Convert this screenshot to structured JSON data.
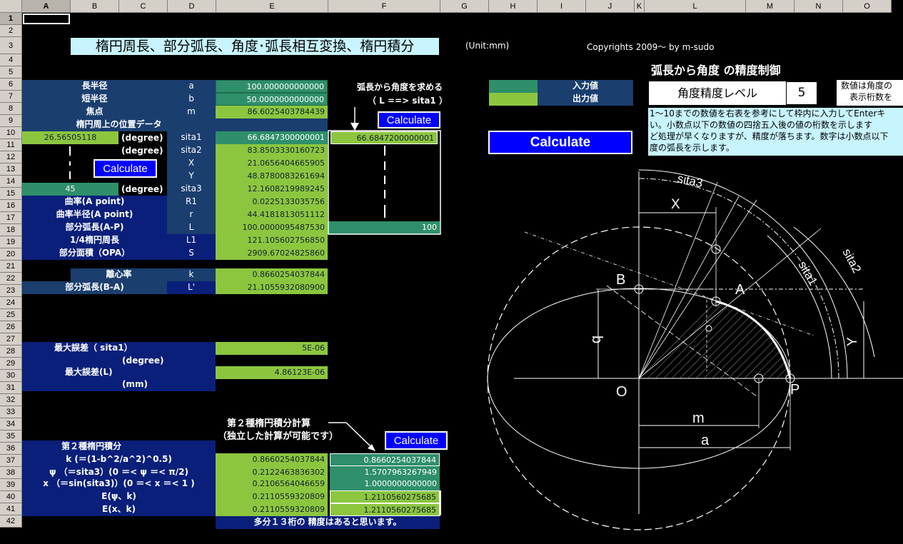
{
  "columns": [
    "A",
    "B",
    "C",
    "D",
    "E",
    "F",
    "G",
    "H",
    "I",
    "J",
    "K",
    "L",
    "M",
    "N",
    "O"
  ],
  "rows": [
    "1",
    "2",
    "3",
    "4",
    "5",
    "6",
    "7",
    "8",
    "9",
    "10",
    "11",
    "12",
    "13",
    "14",
    "15",
    "16",
    "17",
    "18",
    "19",
    "20",
    "21",
    "22",
    "23",
    "24",
    "25",
    "26",
    "27",
    "28",
    "29",
    "30",
    "31",
    "32",
    "33",
    "34",
    "35",
    "36",
    "37",
    "38",
    "39",
    "40",
    "41",
    "42"
  ],
  "title": "楕円周長、部分弧長、角度･弧長相互変換、楕円積分",
  "unit": "(Unit:mm)",
  "copyright": "Copyrights 2009～ by m-sudo",
  "params": [
    {
      "label": "長半径",
      "sym": "a",
      "value": "100.000000000000"
    },
    {
      "label": "短半径",
      "sym": "b",
      "value": "50.0000000000000"
    },
    {
      "label": "焦点",
      "sym": "m",
      "value": "86.6025403784439"
    }
  ],
  "position_header": "楕円周上の位置データ",
  "rows10": {
    "input": "26.56505118",
    "deg": "(degree)",
    "sym": "sita1",
    "value": "66.6847300000001",
    "out": "66.6847200000001"
  },
  "rows11": {
    "deg": "(degree)",
    "sym": "sita2",
    "value": "83.8503330160723"
  },
  "rows12": {
    "sym": "X",
    "value": "21.0656404665905"
  },
  "rows13": {
    "sym": "Y",
    "value": "48.8780083261694"
  },
  "rows14": {
    "input": "45",
    "deg": "(degree)",
    "sym": "sita3",
    "value": "12.1608219989245"
  },
  "rows15": {
    "label": "曲率(A point)",
    "sym": "R1",
    "value": "0.0225133035756"
  },
  "rows16": {
    "label": "曲率半径(A point)",
    "sym": "r",
    "value": "44.4181813051112"
  },
  "rows17": {
    "label": "部分弧長(A-P)",
    "sym": "L",
    "value": "100.0000095487530",
    "out": "100"
  },
  "rows18": {
    "label": "1/4楕円周長",
    "sym": "L1",
    "value": "121.105602756850"
  },
  "rows19": {
    "label": "部分面積（OPA）",
    "sym": "S",
    "value": "2909.67024825860"
  },
  "rows21": {
    "label": "離心率",
    "sym": "k",
    "value": "0.8660254037844"
  },
  "rows22": {
    "label": "部分弧長(B-A)",
    "sym": "L'",
    "value": "21.1055932080900"
  },
  "err1_label": "最大誤差（ sita1）",
  "err1_unit": "(degree)",
  "err1_value": "5E-06",
  "err2_label": "最大誤差(L)",
  "err2_unit": "(mm)",
  "err2_value": "4.86123E-06",
  "arc_to_angle": "弧長から角度を求める",
  "arc_to_angle_sub": "（ L ==> sita1 ）",
  "calc_label": "Calculate",
  "legend_input": "入力値",
  "legend_output": "出力値",
  "precision_title": "弧長から角度 の精度制御",
  "precision_label": "角度精度レベル",
  "precision_value": "5",
  "precision_note_right1": "数値は角度の",
  "precision_note_right2": "表示桁数を",
  "precision_desc": [
    "1～10までの数値を右表を参考にして枠内に入力してEnterキ",
    "い。小数点以下の数値の四捨五入後の値の桁数を示します",
    "ど処理が早くなりますが、精度が落ちます。数字は小数点以下",
    "度の弧長を示します。"
  ],
  "e2_note1": "第２種楕円積分計算",
  "e2_note2": "（独立した計算が可能です）",
  "e2_header": "第２種楕円積分",
  "e2_rows": [
    {
      "label": "k (＝(1-b^2/a^2)^0.5)",
      "value": "0.8660254037844",
      "out": "0.8660254037844"
    },
    {
      "label": "ψ （＝sita3）(0 ＝< ψ ＝< π/2)",
      "value": "0.2122463836302",
      "out": "1.5707963267949"
    },
    {
      "label": "x （＝sin(sita3)）(0 ＝< x ＝< 1 )",
      "value": "0.2106564046659",
      "out": "1.0000000000000"
    },
    {
      "label": "E(ψ、k)",
      "value": "0.2110559320809",
      "out": "1.2110560275685"
    },
    {
      "label": "E(x、k)",
      "value": "0.2110559320809",
      "out": "1.2110560275685"
    }
  ],
  "accuracy_note": "多分１３桁の 精度はあると思います。",
  "diagram": {
    "sita3": "sita3",
    "sita2": "sita2",
    "sita1": "sita1",
    "X": "X",
    "Y": "Y",
    "A": "A",
    "B": "B",
    "b": "b",
    "O": "O",
    "P": "P",
    "m": "m",
    "a": "a"
  }
}
